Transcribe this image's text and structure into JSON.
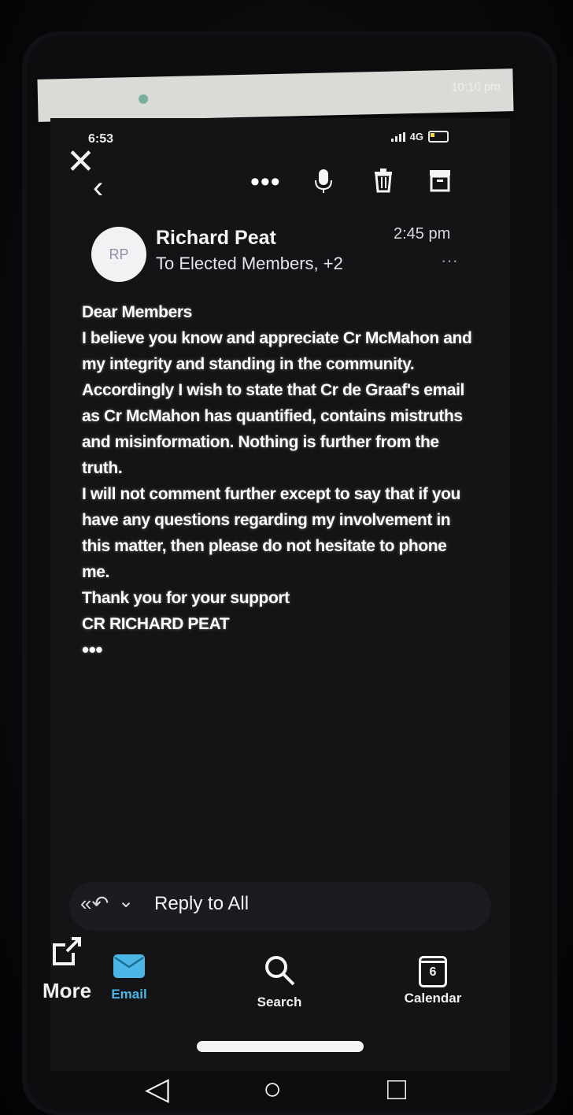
{
  "banner": {
    "text": "10:10 pm"
  },
  "status_bar": {
    "time": "6:53",
    "network": "4G"
  },
  "toolbar": {
    "close_icon": "close-icon",
    "back_icon": "back-chevron-icon",
    "more_label": "•••",
    "icons": [
      "microphone-icon",
      "trash-icon",
      "archive-icon"
    ]
  },
  "email": {
    "avatar_initials": "RP",
    "sender": "Richard Peat",
    "recipients": "To Elected Members, +2",
    "time": "2:45 pm",
    "header_more": "···",
    "body": [
      "Dear Members",
      "I  believe you know and appreciate Cr McMahon and my integrity and standing in the community.",
      "Accordingly I wish to state that Cr de Graaf's email as Cr McMahon has quantified, contains mistruths and misinformation. Nothing is further from the truth.",
      "I will not comment further except to say that if you have any questions regarding my involvement in this matter, then please do not hesitate to phone me."
    ],
    "signoff": "Thank you for your support",
    "signature": "CR RICHARD PEAT",
    "trailing": "•••"
  },
  "reply": {
    "label": "Reply to All"
  },
  "nav": {
    "items": [
      {
        "label": "More",
        "icon": "share-out-icon"
      },
      {
        "label": "Email",
        "icon": "envelope-icon"
      },
      {
        "label": "Search",
        "icon": "search-icon"
      },
      {
        "label": "Calendar",
        "icon": "calendar-icon",
        "badge": "6"
      }
    ]
  },
  "colors": {
    "accent": "#4cb7e6",
    "background": "#141417",
    "text": "#fdfdfd"
  }
}
